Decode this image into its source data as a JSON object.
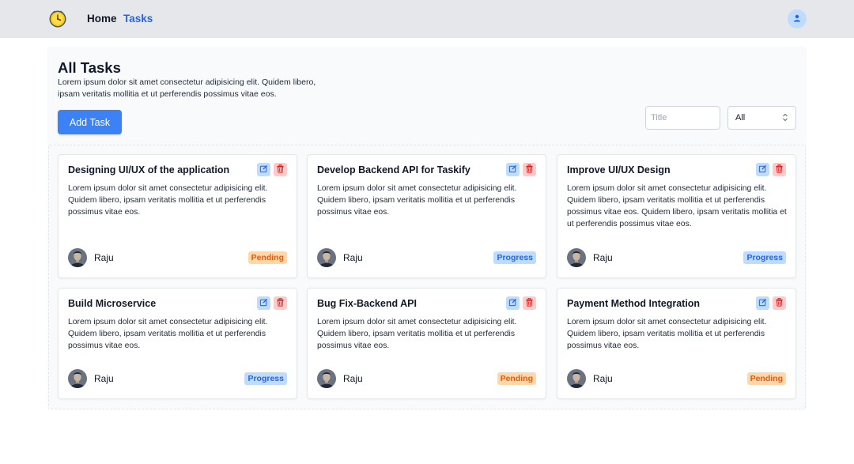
{
  "navbar": {
    "home_label": "Home",
    "tasks_label": "Tasks",
    "logo_icon": "clock-logo-icon",
    "user_icon": "user-icon"
  },
  "header": {
    "title": "All Tasks",
    "description": "Lorem ipsum dolor sit amet consectetur adipisicing elit. Quidem libero, ipsam veritatis mollitia et ut perferendis possimus vitae eos.",
    "add_button_label": "Add Task"
  },
  "filters": {
    "title_placeholder": "Title",
    "title_value": "",
    "status_selected": "All"
  },
  "tasks": [
    {
      "title": "Designing UI/UX of the application",
      "description": "Lorem ipsum dolor sit amet consectetur adipisicing elit. Quidem libero, ipsam veritatis mollitia et ut perferendis possimus vitae eos.",
      "assignee": "Raju",
      "status": "Pending"
    },
    {
      "title": "Develop Backend API for Taskify",
      "description": "Lorem ipsum dolor sit amet consectetur adipisicing elit. Quidem libero, ipsam veritatis mollitia et ut perferendis possimus vitae eos.",
      "assignee": "Raju",
      "status": "Progress"
    },
    {
      "title": "Improve UI/UX Design",
      "description": "Lorem ipsum dolor sit amet consectetur adipisicing elit. Quidem libero, ipsam veritatis mollitia et ut perferendis possimus vitae eos. Quidem libero, ipsam veritatis mollitia et ut perferendis possimus vitae eos.",
      "assignee": "Raju",
      "status": "Progress"
    },
    {
      "title": "Build Microservice",
      "description": "Lorem ipsum dolor sit amet consectetur adipisicing elit. Quidem libero, ipsam veritatis mollitia et ut perferendis possimus vitae eos.",
      "assignee": "Raju",
      "status": "Progress"
    },
    {
      "title": "Bug Fix-Backend API",
      "description": "Lorem ipsum dolor sit amet consectetur adipisicing elit. Quidem libero, ipsam veritatis mollitia et ut perferendis possimus vitae eos.",
      "assignee": "Raju",
      "status": "Pending"
    },
    {
      "title": "Payment Method Integration",
      "description": "Lorem ipsum dolor sit amet consectetur adipisicing elit. Quidem libero, ipsam veritatis mollitia et ut perferendis possimus vitae eos.",
      "assignee": "Raju",
      "status": "Pending"
    }
  ],
  "colors": {
    "accent": "#3b82f6",
    "nav_active": "#2563eb",
    "pending_bg": "#fed7aa",
    "pending_text": "#ea580c",
    "progress_bg": "#bfdbfe",
    "progress_text": "#2563eb"
  }
}
